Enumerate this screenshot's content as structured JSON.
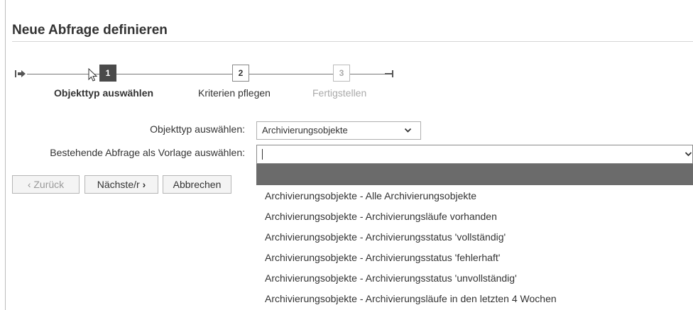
{
  "page": {
    "title": "Neue Abfrage definieren"
  },
  "wizard": {
    "steps": [
      {
        "number": "1",
        "label": "Objekttyp auswählen",
        "state": "active"
      },
      {
        "number": "2",
        "label": "Kriterien pflegen",
        "state": "enabled"
      },
      {
        "number": "3",
        "label": "Fertigstellen",
        "state": "disabled"
      }
    ]
  },
  "form": {
    "object_type_label": "Objekttyp auswählen:",
    "object_type_value": "Archivierungsobjekte",
    "template_label": "Bestehende Abfrage als Vorlage auswählen:",
    "template_value": ""
  },
  "buttons": {
    "back": "Zurück",
    "next": "Nächste/r",
    "cancel": "Abbrechen"
  },
  "dropdown": {
    "items": [
      "Archivierungsobjekte - Alle Archivierungsobjekte",
      "Archivierungsobjekte - Archivierungsläufe vorhanden",
      "Archivierungsobjekte - Archivierungsstatus 'vollständig'",
      "Archivierungsobjekte - Archivierungsstatus 'fehlerhaft'",
      "Archivierungsobjekte - Archivierungsstatus 'unvollständig'",
      "Archivierungsobjekte - Archivierungsläufe in den letzten 4 Wochen"
    ]
  },
  "icons": {
    "wizard_start": "wizard-start-icon",
    "wizard_end": "wizard-end-icon",
    "select_chevron": "chevron-down-icon",
    "back_chevron": "chevron-left-icon",
    "next_chevron": "chevron-right-icon",
    "cursor": "mouse-pointer-icon"
  },
  "colors": {
    "active_step": "#4a4a4a",
    "dropdown_highlight": "#6b6b6b"
  }
}
